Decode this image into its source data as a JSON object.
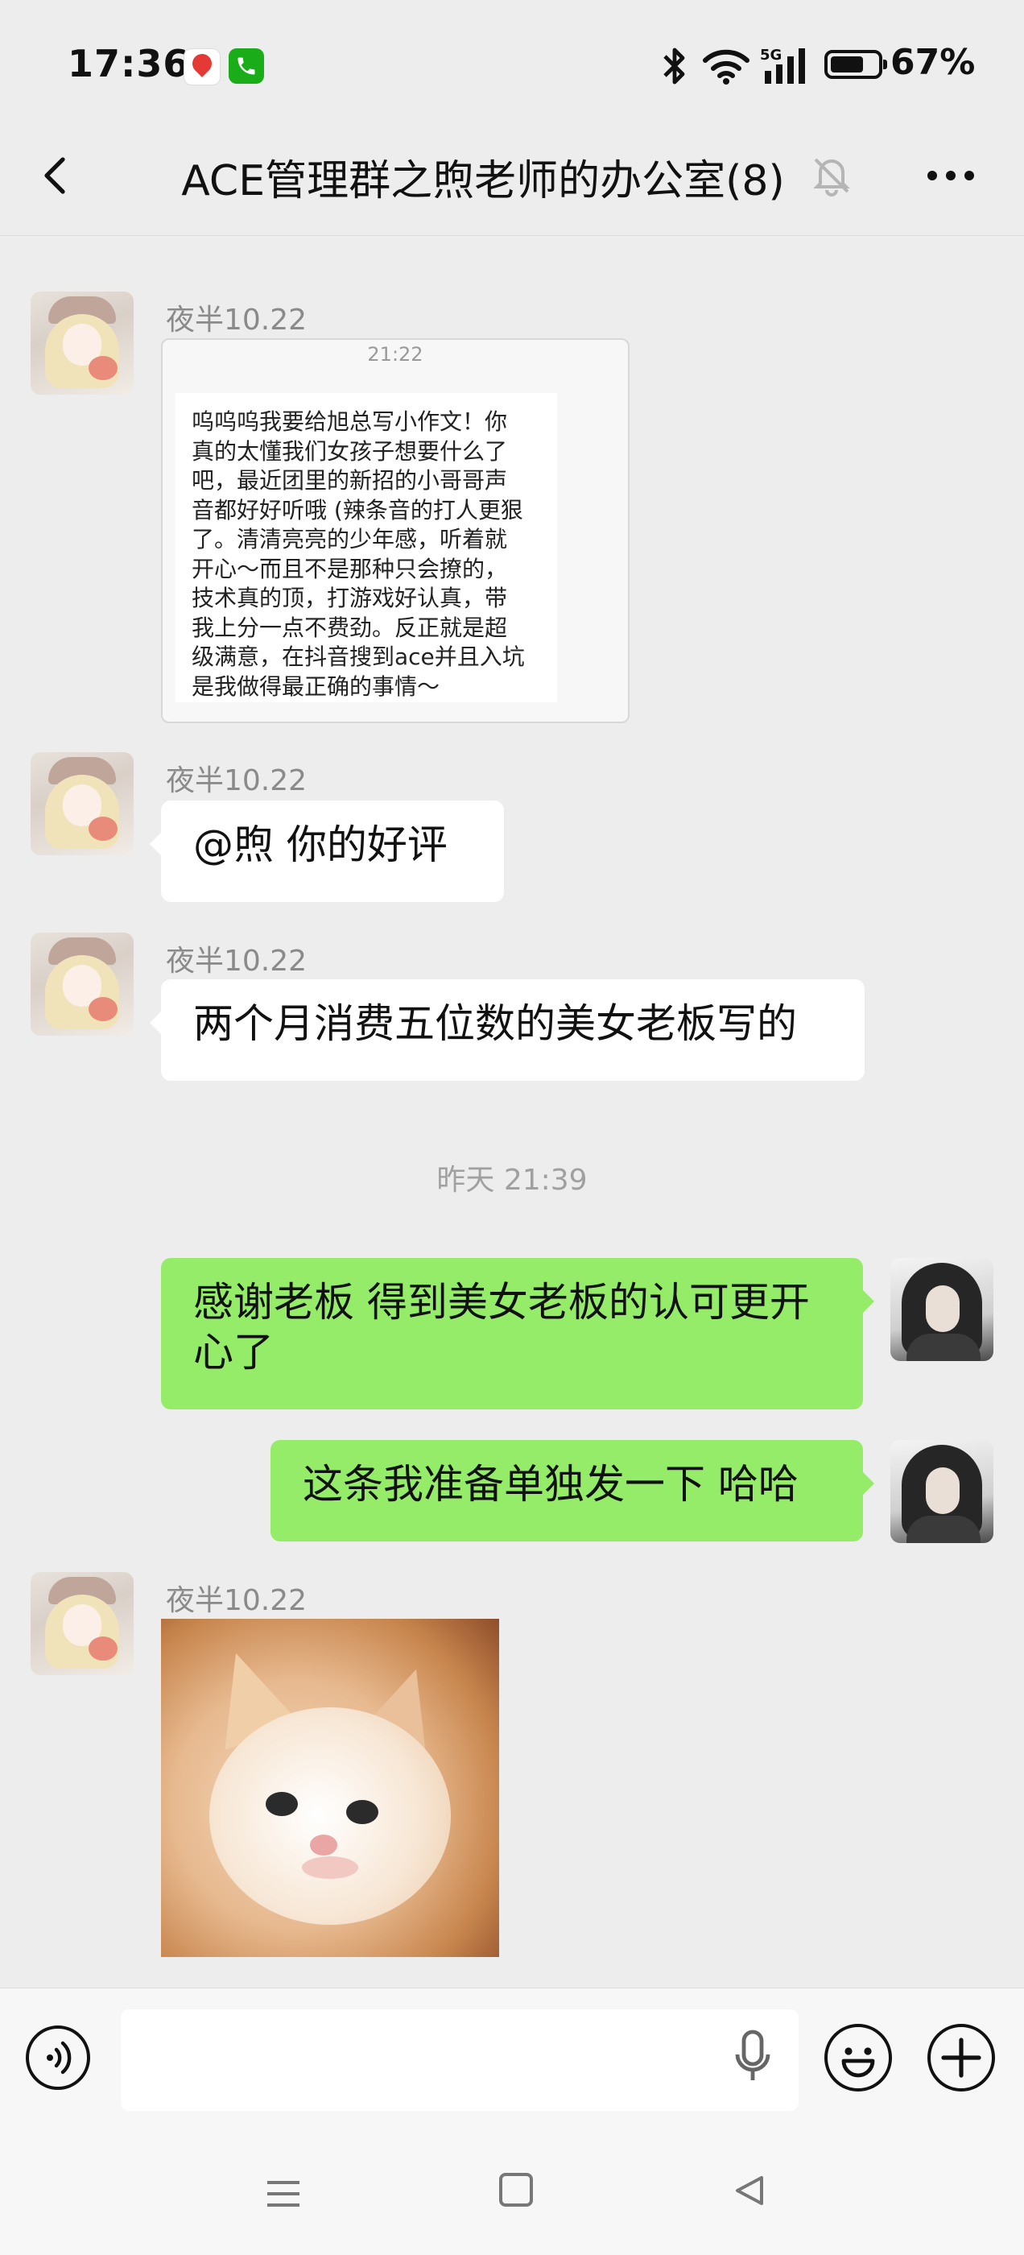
{
  "status_bar": {
    "time": "17:36",
    "notification_icons": [
      "map-pin-icon",
      "phone-icon"
    ],
    "icons": [
      "bluetooth-icon",
      "wifi-icon",
      "signal-5g-icon",
      "battery-icon"
    ],
    "network": "5G",
    "battery_percent": "67%",
    "battery_level": 0.67
  },
  "header": {
    "title": "ACE管理群之煦老师的办公室(8)",
    "back_icon": "chevron-left-icon",
    "muted_icon": "bell-muted-icon",
    "more_icon": "ellipsis-icon"
  },
  "messages": [
    {
      "sender": "夜半10.22",
      "type": "screenshot",
      "screenshot_time": "21:22",
      "screenshot_text": "呜呜呜我要给旭总写小作文！你\n真的太懂我们女孩子想要什么了\n吧，最近团里的新招的小哥哥声\n音都好好听哦 (辣条音的打人更狠\n了。清清亮亮的少年感，听着就\n开心～而且不是那种只会撩的，\n技术真的顶，打游戏好认真，带\n我上分一点不费劲。反正就是超\n级满意，在抖音搜到ace并且入坑\n是我做得最正确的事情～"
    },
    {
      "sender": "夜半10.22",
      "type": "text",
      "text": "@煦  你的好评"
    },
    {
      "sender": "夜半10.22",
      "type": "text",
      "text": "两个月消费五位数的美女老板写的"
    },
    {
      "type": "time_divider",
      "text": "昨天 21:39"
    },
    {
      "type": "text",
      "from_me": true,
      "text": "感谢老板 得到美女老板的认可更开心了"
    },
    {
      "type": "text",
      "from_me": true,
      "text": "这条我准备单独发一下 哈哈"
    },
    {
      "sender": "夜半10.22",
      "type": "sticker",
      "sticker": "kitten-sticker"
    }
  ],
  "input_bar": {
    "voice_icon": "voice-icon",
    "input_value": "",
    "mic_icon": "microphone-icon",
    "emoji_icon": "emoji-icon",
    "plus_icon": "plus-icon"
  },
  "nav_bar": {
    "icons": [
      "menu-icon",
      "home-icon",
      "back-triangle-icon"
    ]
  }
}
